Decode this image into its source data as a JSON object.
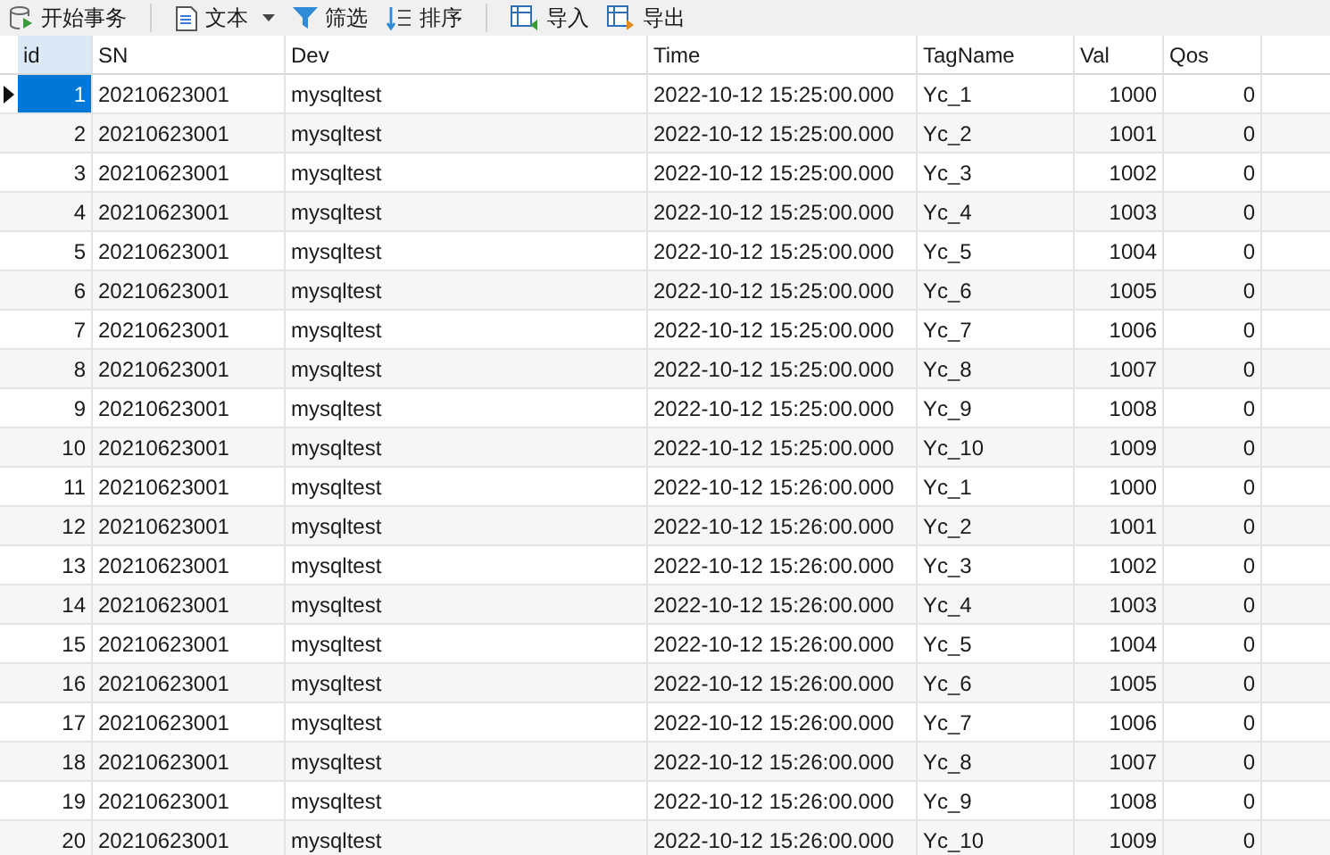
{
  "toolbar": [
    {
      "kind": "transaction",
      "label": "开始事务"
    },
    {
      "kind": "text",
      "label": "文本",
      "dropdown": true
    },
    {
      "kind": "filter",
      "label": "筛选"
    },
    {
      "kind": "sort",
      "label": "排序"
    },
    {
      "kind": "import",
      "label": "导入"
    },
    {
      "kind": "export",
      "label": "导出"
    }
  ],
  "table": {
    "columns": [
      {
        "label": "id",
        "selected": true
      },
      {
        "label": "SN",
        "selected": false
      },
      {
        "label": "Dev",
        "selected": false
      },
      {
        "label": "Time",
        "selected": false
      },
      {
        "label": "TagName",
        "selected": false
      },
      {
        "label": "Val",
        "selected": false
      },
      {
        "label": "Qos",
        "selected": false
      }
    ],
    "rows": [
      {
        "selected": true,
        "cells": [
          "1",
          "20210623001",
          "mysqltest",
          "2022-10-12 15:25:00.000",
          "Yc_1",
          "1000",
          "0"
        ]
      },
      {
        "selected": false,
        "cells": [
          "2",
          "20210623001",
          "mysqltest",
          "2022-10-12 15:25:00.000",
          "Yc_2",
          "1001",
          "0"
        ]
      },
      {
        "selected": false,
        "cells": [
          "3",
          "20210623001",
          "mysqltest",
          "2022-10-12 15:25:00.000",
          "Yc_3",
          "1002",
          "0"
        ]
      },
      {
        "selected": false,
        "cells": [
          "4",
          "20210623001",
          "mysqltest",
          "2022-10-12 15:25:00.000",
          "Yc_4",
          "1003",
          "0"
        ]
      },
      {
        "selected": false,
        "cells": [
          "5",
          "20210623001",
          "mysqltest",
          "2022-10-12 15:25:00.000",
          "Yc_5",
          "1004",
          "0"
        ]
      },
      {
        "selected": false,
        "cells": [
          "6",
          "20210623001",
          "mysqltest",
          "2022-10-12 15:25:00.000",
          "Yc_6",
          "1005",
          "0"
        ]
      },
      {
        "selected": false,
        "cells": [
          "7",
          "20210623001",
          "mysqltest",
          "2022-10-12 15:25:00.000",
          "Yc_7",
          "1006",
          "0"
        ]
      },
      {
        "selected": false,
        "cells": [
          "8",
          "20210623001",
          "mysqltest",
          "2022-10-12 15:25:00.000",
          "Yc_8",
          "1007",
          "0"
        ]
      },
      {
        "selected": false,
        "cells": [
          "9",
          "20210623001",
          "mysqltest",
          "2022-10-12 15:25:00.000",
          "Yc_9",
          "1008",
          "0"
        ]
      },
      {
        "selected": false,
        "cells": [
          "10",
          "20210623001",
          "mysqltest",
          "2022-10-12 15:25:00.000",
          "Yc_10",
          "1009",
          "0"
        ]
      },
      {
        "selected": false,
        "cells": [
          "11",
          "20210623001",
          "mysqltest",
          "2022-10-12 15:26:00.000",
          "Yc_1",
          "1000",
          "0"
        ]
      },
      {
        "selected": false,
        "cells": [
          "12",
          "20210623001",
          "mysqltest",
          "2022-10-12 15:26:00.000",
          "Yc_2",
          "1001",
          "0"
        ]
      },
      {
        "selected": false,
        "cells": [
          "13",
          "20210623001",
          "mysqltest",
          "2022-10-12 15:26:00.000",
          "Yc_3",
          "1002",
          "0"
        ]
      },
      {
        "selected": false,
        "cells": [
          "14",
          "20210623001",
          "mysqltest",
          "2022-10-12 15:26:00.000",
          "Yc_4",
          "1003",
          "0"
        ]
      },
      {
        "selected": false,
        "cells": [
          "15",
          "20210623001",
          "mysqltest",
          "2022-10-12 15:26:00.000",
          "Yc_5",
          "1004",
          "0"
        ]
      },
      {
        "selected": false,
        "cells": [
          "16",
          "20210623001",
          "mysqltest",
          "2022-10-12 15:26:00.000",
          "Yc_6",
          "1005",
          "0"
        ]
      },
      {
        "selected": false,
        "cells": [
          "17",
          "20210623001",
          "mysqltest",
          "2022-10-12 15:26:00.000",
          "Yc_7",
          "1006",
          "0"
        ]
      },
      {
        "selected": false,
        "cells": [
          "18",
          "20210623001",
          "mysqltest",
          "2022-10-12 15:26:00.000",
          "Yc_8",
          "1007",
          "0"
        ]
      },
      {
        "selected": false,
        "cells": [
          "19",
          "20210623001",
          "mysqltest",
          "2022-10-12 15:26:00.000",
          "Yc_9",
          "1008",
          "0"
        ]
      },
      {
        "selected": false,
        "cells": [
          "20",
          "20210623001",
          "mysqltest",
          "2022-10-12 15:26:00.000",
          "Yc_10",
          "1009",
          "0"
        ]
      }
    ]
  }
}
